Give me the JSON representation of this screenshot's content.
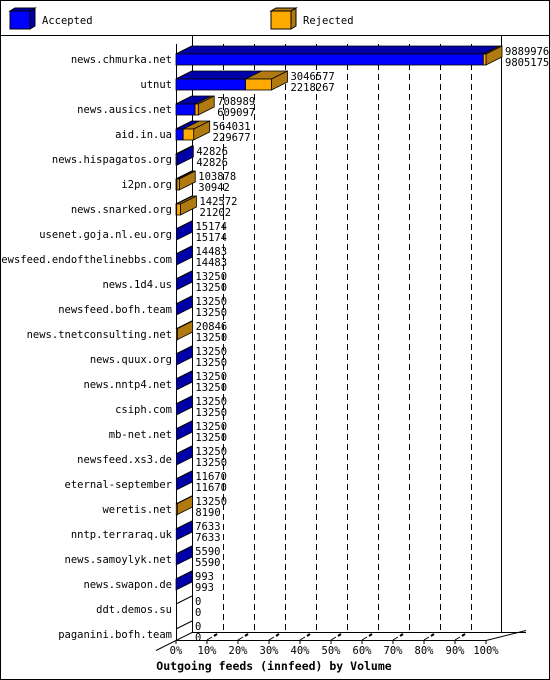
{
  "chart_data": {
    "type": "bar",
    "orientation": "horizontal",
    "stacked": true,
    "title": "Outgoing feeds (innfeed) by Volume",
    "xlabel": "",
    "ylabel": "",
    "xlim_percent": [
      0,
      100
    ],
    "x_ticks": [
      "0%",
      "10%",
      "20%",
      "30%",
      "40%",
      "50%",
      "60%",
      "70%",
      "80%",
      "90%",
      "100%"
    ],
    "grid": true,
    "legend": {
      "placement": "top",
      "entries": [
        {
          "name": "Accepted",
          "color": "#0000ff"
        },
        {
          "name": "Rejected",
          "color": "#ffaa00"
        }
      ]
    },
    "colors": {
      "accepted_front": "#0000ff",
      "accepted_shade": "#0000a8",
      "rejected_front": "#ffaa00",
      "rejected_shade": "#b07a10"
    },
    "categories": [
      "news.chmurka.net",
      "utnut",
      "news.ausics.net",
      "aid.in.ua",
      "news.hispagatos.org",
      "i2pn.org",
      "news.snarked.org",
      "usenet.goja.nl.eu.org",
      "newsfeed.endofthelinebbs.com",
      "news.1d4.us",
      "newsfeed.bofh.team",
      "news.tnetconsulting.net",
      "news.quux.org",
      "news.nntp4.net",
      "csiph.com",
      "mb-net.net",
      "newsfeed.xs3.de",
      "eternal-september",
      "weretis.net",
      "nntp.terraraq.uk",
      "news.samoylyk.net",
      "news.swapon.de",
      "ddt.demos.su",
      "paganini.bofh.team"
    ],
    "offered": [
      9889976,
      3046577,
      708989,
      564031,
      42826,
      103878,
      142572,
      15174,
      14483,
      13250,
      13250,
      20846,
      13250,
      13250,
      13250,
      13250,
      13250,
      11670,
      13250,
      7633,
      5590,
      993,
      0,
      0
    ],
    "accepted": [
      9805175,
      2218267,
      609097,
      229677,
      42826,
      30942,
      21202,
      15174,
      14483,
      13250,
      13250,
      13250,
      13250,
      13250,
      13250,
      13250,
      13250,
      11670,
      8190,
      7633,
      5590,
      993,
      0,
      0
    ],
    "series": [
      {
        "name": "Accepted",
        "values": [
          9805175,
          2218267,
          609097,
          229677,
          42826,
          30942,
          21202,
          15174,
          14483,
          13250,
          13250,
          13250,
          13250,
          13250,
          13250,
          13250,
          13250,
          11670,
          8190,
          7633,
          5590,
          993,
          0,
          0
        ]
      },
      {
        "name": "Rejected",
        "values": [
          84801,
          828310,
          99892,
          334354,
          0,
          72936,
          121370,
          0,
          0,
          0,
          0,
          7596,
          0,
          0,
          0,
          0,
          0,
          0,
          5060,
          0,
          0,
          0,
          0,
          0
        ]
      }
    ]
  }
}
